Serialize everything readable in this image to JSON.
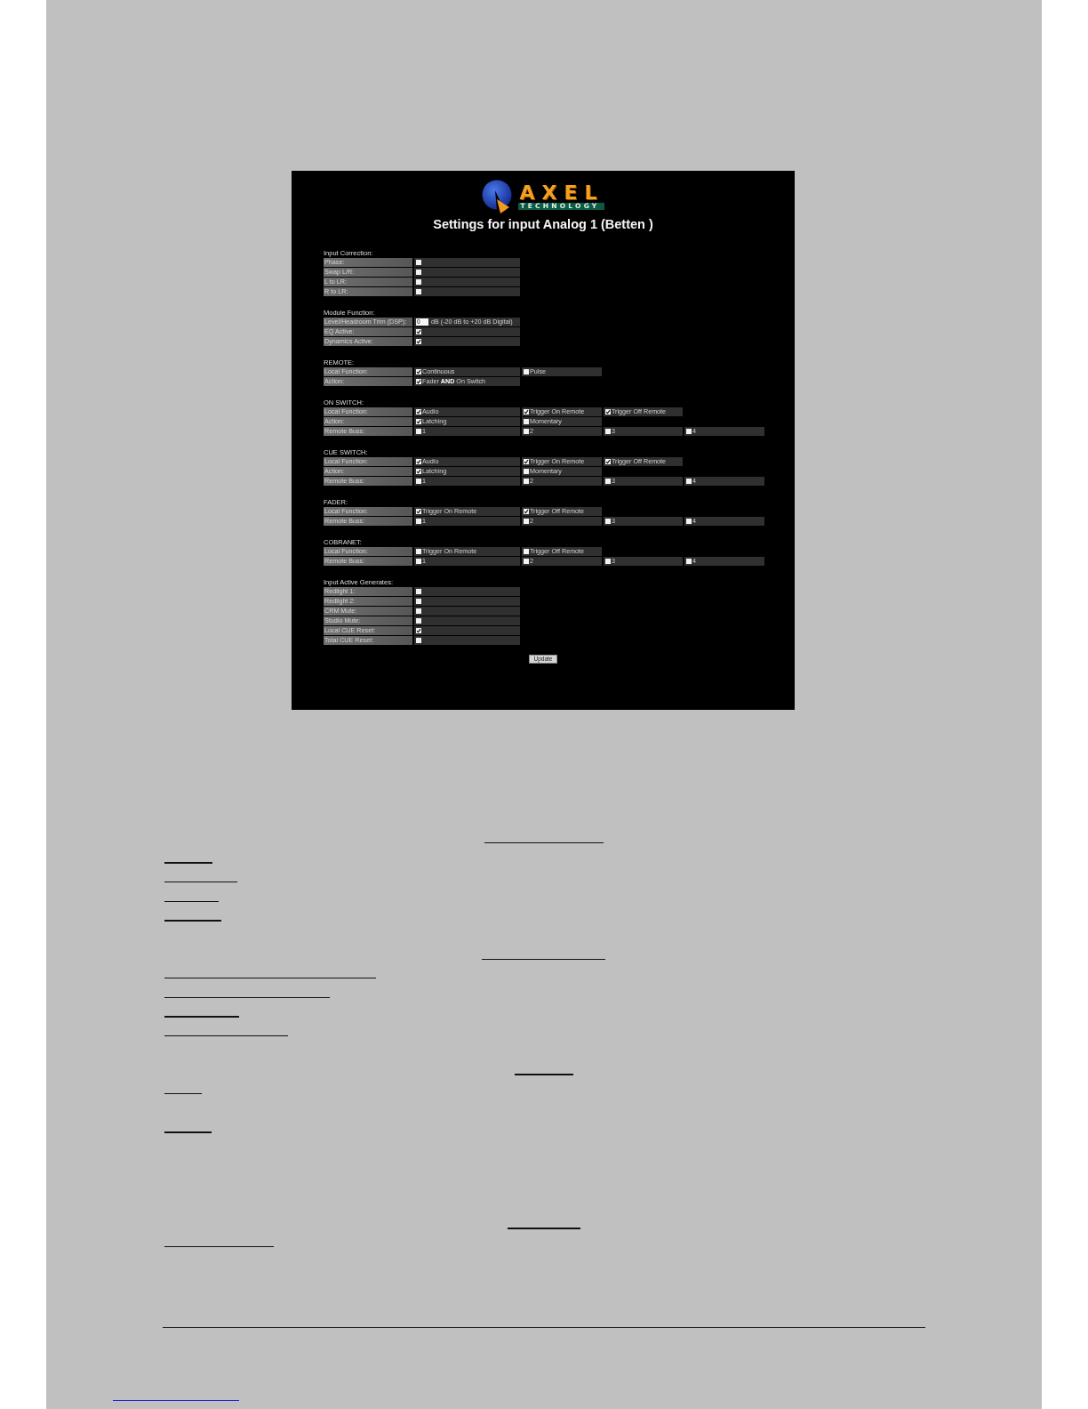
{
  "screenshot": {
    "logo": {
      "wordmark": "AXEL",
      "tagline": "TECHNOLOGY"
    },
    "title": "Settings for input Analog 1 (Betten )",
    "sections": [
      {
        "heading": "Input Correction:",
        "rows": [
          {
            "kind": "check",
            "label": "Phase:",
            "checked": false
          },
          {
            "kind": "check",
            "label": "Swap L/R:",
            "checked": false
          },
          {
            "kind": "check",
            "label": "L to LR:",
            "checked": false
          },
          {
            "kind": "check",
            "label": "R to LR:",
            "checked": false
          }
        ]
      },
      {
        "heading": "Module Function:",
        "rows": [
          {
            "kind": "number",
            "label": "Level/Headroom Trim (DSP):",
            "value": "0",
            "unit": "dB (-20 dB to +20 dB Digital)"
          },
          {
            "kind": "check",
            "label": "EQ Active:",
            "checked": true
          },
          {
            "kind": "check",
            "label": "Dynamics Active:",
            "checked": true
          }
        ]
      },
      {
        "heading": "REMOTE:",
        "rows": [
          {
            "kind": "options",
            "label": "Local Function:",
            "options": [
              {
                "label": "Continuous",
                "checked": true
              },
              {
                "label": "Pulse",
                "checked": false
              }
            ]
          },
          {
            "kind": "options",
            "label": "Action:",
            "options": [
              {
                "label": "Fader **AND** On Switch",
                "checked": true
              }
            ]
          }
        ]
      },
      {
        "heading": "ON SWITCH:",
        "rows": [
          {
            "kind": "options",
            "label": "Local Function:",
            "options": [
              {
                "label": "Audio",
                "checked": true
              },
              {
                "label": "Trigger On Remote",
                "checked": true
              },
              {
                "label": "Trigger Off Remote",
                "checked": true
              }
            ]
          },
          {
            "kind": "options",
            "label": "Action:",
            "options": [
              {
                "label": "Latching",
                "checked": true
              },
              {
                "label": "Momentary",
                "checked": false
              }
            ]
          },
          {
            "kind": "options",
            "label": "Remote Buss:",
            "options": [
              {
                "label": "1",
                "checked": false
              },
              {
                "label": "2",
                "checked": false
              },
              {
                "label": "3",
                "checked": false
              },
              {
                "label": "4",
                "checked": false
              }
            ]
          }
        ]
      },
      {
        "heading": "CUE SWITCH:",
        "rows": [
          {
            "kind": "options",
            "label": "Local Function:",
            "options": [
              {
                "label": "Audio",
                "checked": true
              },
              {
                "label": "Trigger On Remote",
                "checked": true
              },
              {
                "label": "Trigger Off Remote",
                "checked": true
              }
            ]
          },
          {
            "kind": "options",
            "label": "Action:",
            "options": [
              {
                "label": "Latching",
                "checked": true
              },
              {
                "label": "Momentary",
                "checked": false
              }
            ]
          },
          {
            "kind": "options",
            "label": "Remote Buss:",
            "options": [
              {
                "label": "1",
                "checked": false
              },
              {
                "label": "2",
                "checked": false
              },
              {
                "label": "3",
                "checked": false
              },
              {
                "label": "4",
                "checked": false
              }
            ]
          }
        ]
      },
      {
        "heading": "FADER:",
        "rows": [
          {
            "kind": "options",
            "label": "Local Function:",
            "options": [
              {
                "label": "Trigger On Remote",
                "checked": true
              },
              {
                "label": "Trigger Off Remote",
                "checked": true
              }
            ]
          },
          {
            "kind": "options",
            "label": "Remote Buss:",
            "options": [
              {
                "label": "1",
                "checked": false
              },
              {
                "label": "2",
                "checked": false
              },
              {
                "label": "3",
                "checked": false
              },
              {
                "label": "4",
                "checked": false
              }
            ]
          }
        ]
      },
      {
        "heading": "COBRANET:",
        "rows": [
          {
            "kind": "options",
            "label": "Local Function:",
            "options": [
              {
                "label": "Trigger On Remote",
                "checked": false
              },
              {
                "label": "Trigger Off Remote",
                "checked": false
              }
            ]
          },
          {
            "kind": "options",
            "label": "Remote Buss:",
            "options": [
              {
                "label": "1",
                "checked": false
              },
              {
                "label": "2",
                "checked": false
              },
              {
                "label": "3",
                "checked": false
              },
              {
                "label": "4",
                "checked": false
              }
            ]
          }
        ]
      },
      {
        "heading": "Input Active Generates:",
        "rows": [
          {
            "kind": "check",
            "label": "Redlight 1:",
            "checked": false
          },
          {
            "kind": "check",
            "label": "Redlight 2:",
            "checked": false
          },
          {
            "kind": "check",
            "label": "CRM Mute:",
            "checked": false
          },
          {
            "kind": "check",
            "label": "Studio Mute:",
            "checked": false
          },
          {
            "kind": "check",
            "label": "Local CUE Reset:",
            "checked": true
          },
          {
            "kind": "check",
            "label": "Total CUE Reset:",
            "checked": false
          }
        ]
      }
    ],
    "update_button": "Update"
  }
}
